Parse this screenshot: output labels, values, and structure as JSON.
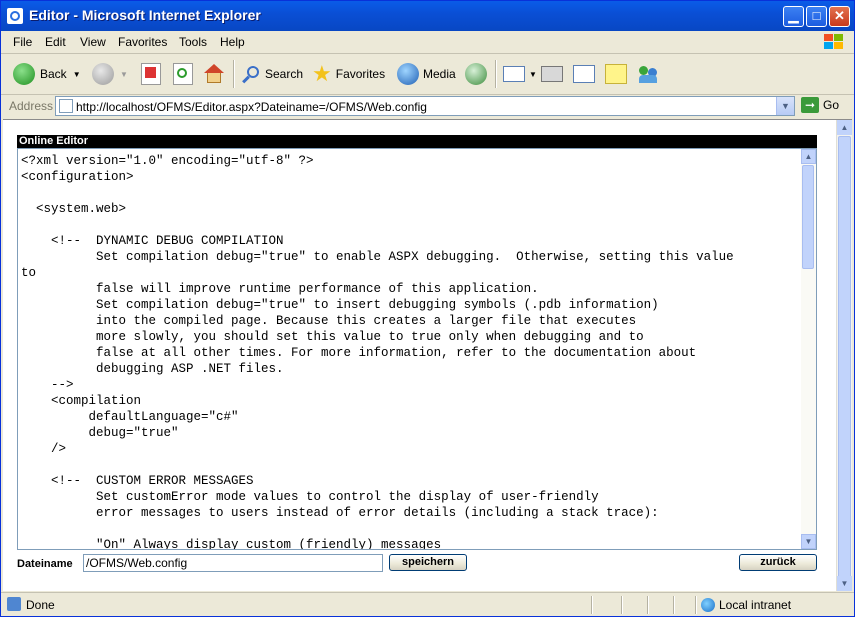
{
  "window": {
    "title": "Editor - Microsoft Internet Explorer"
  },
  "menu": {
    "items": [
      "File",
      "Edit",
      "View",
      "Favorites",
      "Tools",
      "Help"
    ]
  },
  "toolbar": {
    "back_label": "Back",
    "search_label": "Search",
    "favorites_label": "Favorites",
    "media_label": "Media"
  },
  "address": {
    "label": "Address",
    "url": "http://localhost/OFMS/Editor.aspx?Dateiname=/OFMS/Web.config",
    "go_label": "Go"
  },
  "editor": {
    "header": "Online Editor",
    "content": "<?xml version=\"1.0\" encoding=\"utf-8\" ?>\n<configuration>\n\n  <system.web>\n\n    <!--  DYNAMIC DEBUG COMPILATION\n          Set compilation debug=\"true\" to enable ASPX debugging.  Otherwise, setting this value\nto\n          false will improve runtime performance of this application.\n          Set compilation debug=\"true\" to insert debugging symbols (.pdb information)\n          into the compiled page. Because this creates a larger file that executes\n          more slowly, you should set this value to true only when debugging and to\n          false at all other times. For more information, refer to the documentation about\n          debugging ASP .NET files.\n    -->\n    <compilation\n         defaultLanguage=\"c#\"\n         debug=\"true\"\n    />\n\n    <!--  CUSTOM ERROR MESSAGES\n          Set customError mode values to control the display of user-friendly\n          error messages to users instead of error details (including a stack trace):\n\n          \"On\" Always display custom (friendly) messages",
    "filename_label": "Dateiname",
    "filename_value": "/OFMS/Web.config",
    "save_button": "speichern",
    "back_button": "zurück"
  },
  "status": {
    "text": "Done",
    "zone": "Local intranet"
  }
}
